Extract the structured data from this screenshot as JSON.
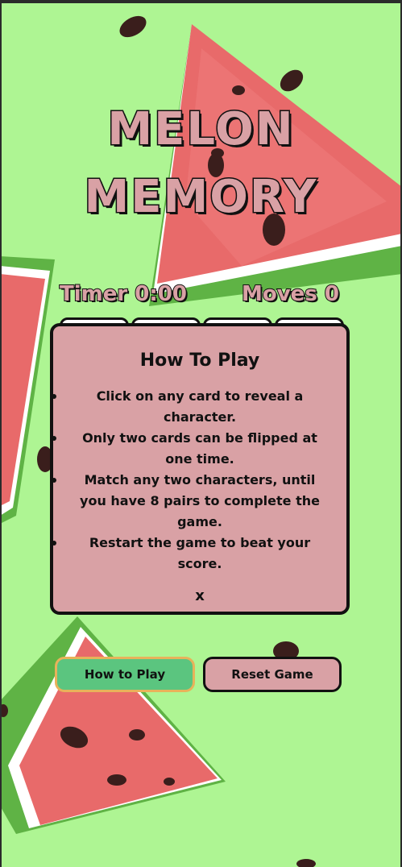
{
  "game": {
    "title_line1": "MELON",
    "title_line2": "MEMORY",
    "timer_label": "Timer 0:00",
    "moves_label": "Moves 0"
  },
  "modal": {
    "title": "How To Play",
    "rules": [
      "Click on any card to reveal a character.",
      "Only two cards can be flipped at one time.",
      "Match any two characters, until you have 8 pairs to complete the game.",
      "Restart the game to beat your score."
    ],
    "close_label": "x"
  },
  "buttons": {
    "how_to_play": "How to Play",
    "reset_game": "Reset Game"
  },
  "colors": {
    "background": "#aef593",
    "title_fill": "#d9a1a5",
    "modal_bg": "#d9a1a5",
    "how_button": "#5bc57f",
    "melon_flesh": "#e86a6a",
    "melon_rind": "#5fb345"
  }
}
